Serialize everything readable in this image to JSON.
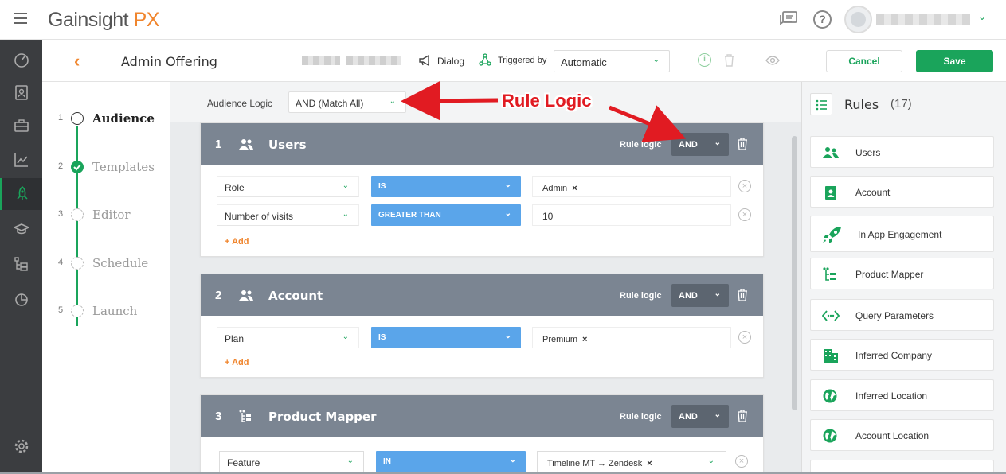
{
  "app": {
    "logo_main": "Gainsight",
    "logo_px": "PX"
  },
  "header": {
    "page_title": "Admin Offering",
    "dialog_label": "Dialog",
    "triggered_by_label": "Triggered by",
    "trigger_value": "Automatic",
    "cancel_label": "Cancel",
    "save_label": "Save"
  },
  "steps": [
    {
      "num": "1",
      "label": "Audience",
      "state": "current"
    },
    {
      "num": "2",
      "label": "Templates",
      "state": "done"
    },
    {
      "num": "3",
      "label": "Editor",
      "state": "pending"
    },
    {
      "num": "4",
      "label": "Schedule",
      "state": "pending"
    },
    {
      "num": "5",
      "label": "Launch",
      "state": "pending"
    }
  ],
  "audience": {
    "label": "Audience Logic",
    "value": "AND (Match All)"
  },
  "annotation": {
    "text": "Rule Logic",
    "color": "#e11b22"
  },
  "cards": [
    {
      "num": "1",
      "title": "Users",
      "rule_logic_label": "Rule logic",
      "rule_logic_value": "AND",
      "conditions": [
        {
          "field": "Role",
          "operator": "IS",
          "value": "Admin",
          "chip": true
        },
        {
          "field": "Number of visits",
          "operator": "GREATER THAN",
          "value": "10",
          "chip": false
        }
      ],
      "add_label": "+ Add"
    },
    {
      "num": "2",
      "title": "Account",
      "rule_logic_label": "Rule logic",
      "rule_logic_value": "AND",
      "conditions": [
        {
          "field": "Plan",
          "operator": "IS",
          "value": "Premium",
          "chip": true
        }
      ],
      "add_label": "+ Add"
    },
    {
      "num": "3",
      "title": "Product Mapper",
      "rule_logic_label": "Rule logic",
      "rule_logic_value": "AND",
      "conditions": [
        {
          "field": "Feature",
          "operator": "IN",
          "value": "Timeline MT → Zendesk",
          "chip": true
        }
      ]
    }
  ],
  "rules_panel": {
    "title": "Rules",
    "count": "(17)",
    "items": [
      {
        "label": "Users",
        "icon": "users-icon"
      },
      {
        "label": "Account",
        "icon": "account-icon"
      },
      {
        "label": "In App Engagement",
        "icon": "rocket-icon"
      },
      {
        "label": "Product Mapper",
        "icon": "product-mapper-icon"
      },
      {
        "label": "Query Parameters",
        "icon": "query-parameters-icon"
      },
      {
        "label": "Inferred Company",
        "icon": "building-icon"
      },
      {
        "label": "Inferred Location",
        "icon": "globe-icon"
      },
      {
        "label": "Account Location",
        "icon": "globe-icon"
      }
    ]
  },
  "colors": {
    "accent_green": "#1aa45b",
    "accent_orange": "#f0852d",
    "operator_blue": "#5aa5ea",
    "card_header": "#7b8592",
    "nav_dark": "#3b3d40"
  }
}
